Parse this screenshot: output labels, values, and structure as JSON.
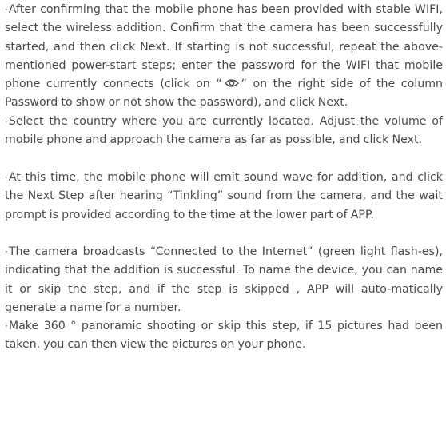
{
  "document": {
    "bullet_marker": "·",
    "paragraphs": [
      {
        "before_icon": "After confirming that the mobile phone has been provided with stable WIFI, select the wireless addition. Confirm that the camera has been successfully started, and then click Next. If starting is not successful, repeat the above-mentioned power-start steps; enter the password for the WIFI that mobile phone currently connects (click on “",
        "icon": "eye-icon",
        "after_icon": "” on the right side of the column Password to show or not show the password), and click Next."
      },
      {
        "text": "Select the country where you are currently located. Adjust the volume of mobile phone and approach the camera as far as possible, and click Next."
      },
      {
        "text": "At this time, the mobile phone will emit sound wave for addition, and click the Next Step after hearing “Tinkling” sound from the camera, and the wait prompt is provided according to the time at the lower part of APP."
      },
      {
        "text": "The camera broadcasts “Connected to the Internet” (green light flash-es), indicating that the addition is successful. To name the device, you can name it or skip the step, and if the step is skipped , APP will auto-matically generate a name for a number."
      },
      {
        "text": "Make 360 ° panoramic shooting or skip this step, if 15 pictures had been taken, you can then view the pictures on your phone."
      }
    ]
  }
}
